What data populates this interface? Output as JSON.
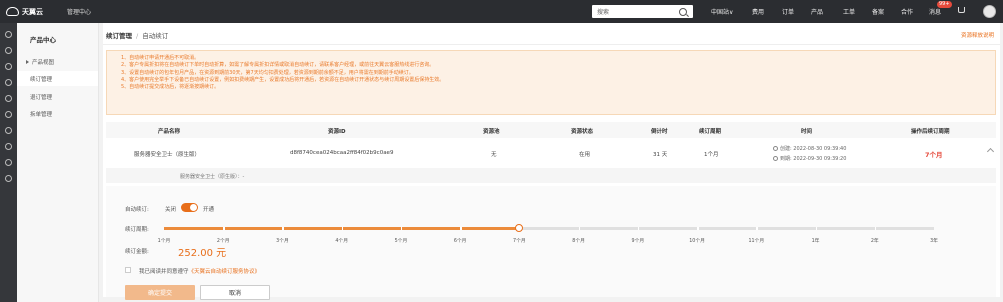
{
  "topbar": {
    "brand": "天翼云",
    "mgmt_center": "管理中心",
    "search_placeholder": "搜索",
    "nav": [
      "中国站∨",
      "费用",
      "订单",
      "产品",
      "工单",
      "备案",
      "合作",
      "消息"
    ],
    "message_badge": "99+"
  },
  "sidebar": {
    "title": "产品中心",
    "items": [
      "产品视图",
      "续订管理",
      "退订管理",
      "拆单管理"
    ]
  },
  "breadcrumb": {
    "level1": "续订管理",
    "level2": "自动续订"
  },
  "help_link": "资源释放说明",
  "notice": [
    "1、自动续订申请开通后不可取消。",
    "2、客户专属折扣将在自动续订下单时自动折算，如需了解专属折扣详情或取消自动续订，请联系客户经理，或前往天翼云客服热线进行咨询。",
    "3、设置自动续订的包年包月产品，在资源到期前30天，第7天均匀扣费处理，若资源到期前余额不足，用户将需在到期前手动续订。",
    "4、客户使用完全举手下设备已自动续订设置，例如扣费续期产生，设置成功后将开通后，若资源在自动续订开通状态与续订周期设置后保持生效。",
    "5、自动续订提交成功后，将逐渐按期续订。"
  ],
  "table": {
    "headers": [
      "产品名称",
      "资源ID",
      "资源池",
      "资源状态",
      "倒计时",
      "续订周期",
      "时间",
      "操作后续订周期"
    ],
    "row": {
      "product": "服务器安全卫士（原生版）",
      "resource_id": "d8f8740cea024bcaa2ff84f02b9c0ae9",
      "pool": "无",
      "status": "在用",
      "countdown": "31 天",
      "cycle": "1个月",
      "created": "创建: 2022-08-30 09:39:40",
      "expires": "到期: 2022-09-30 09:39:20",
      "after_cycle": "7个月"
    },
    "subrow": "服务器安全卫士（原生版）：-"
  },
  "form": {
    "auto_renew_label": "自动续订:",
    "off_label": "关闭",
    "on_label": "开通",
    "period_label": "续订周期:",
    "period_options": [
      "1个月",
      "2个月",
      "3个月",
      "4个月",
      "5个月",
      "6个月",
      "7个月",
      "8个月",
      "9个月",
      "10个月",
      "11个月",
      "1年",
      "2年",
      "3年"
    ],
    "selected_period": "7个月",
    "selected_index": 6,
    "amount_label": "续订金额:",
    "amount": "252.00 元",
    "agree_text": "我已阅读并同意遵守",
    "agree_link": "《天翼云自动续订服务协议》",
    "confirm_button": "确定提交",
    "cancel_button": "取消"
  },
  "colors": {
    "accent": "#e86e1a",
    "topbar": "#2b2d31",
    "danger": "#e64a3c"
  }
}
